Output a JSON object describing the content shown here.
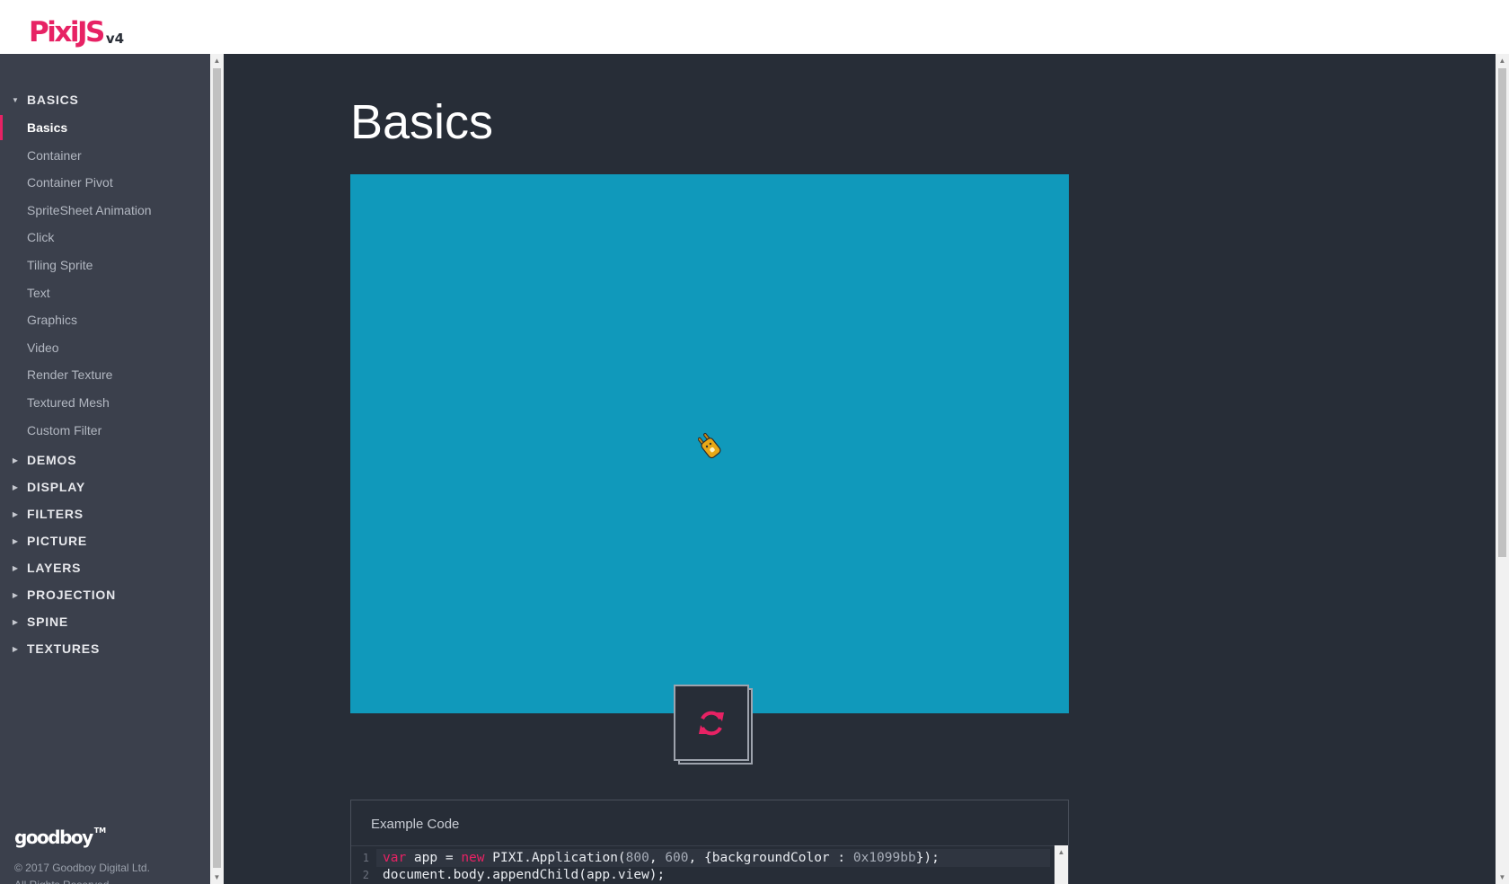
{
  "header": {
    "logo_text": "PixiJS",
    "logo_version": "v4"
  },
  "sidebar": {
    "sections": [
      {
        "label": "BASICS",
        "expanded": true
      },
      {
        "label": "DEMOS",
        "expanded": false
      },
      {
        "label": "DISPLAY",
        "expanded": false
      },
      {
        "label": "FILTERS",
        "expanded": false
      },
      {
        "label": "PICTURE",
        "expanded": false
      },
      {
        "label": "LAYERS",
        "expanded": false
      },
      {
        "label": "PROJECTION",
        "expanded": false
      },
      {
        "label": "SPINE",
        "expanded": false
      },
      {
        "label": "TEXTURES",
        "expanded": false
      }
    ],
    "basics_items": [
      {
        "label": "Basics",
        "active": true
      },
      {
        "label": "Container"
      },
      {
        "label": "Container Pivot"
      },
      {
        "label": "SpriteSheet Animation"
      },
      {
        "label": "Click"
      },
      {
        "label": "Tiling Sprite"
      },
      {
        "label": "Text"
      },
      {
        "label": "Graphics"
      },
      {
        "label": "Video"
      },
      {
        "label": "Render Texture"
      },
      {
        "label": "Textured Mesh"
      },
      {
        "label": "Custom Filter"
      }
    ],
    "brand": "goodboy",
    "brand_tm": "TM",
    "copyright_line1": "© 2017 Goodboy Digital Ltd.",
    "copyright_line2": "All Rights Reserved."
  },
  "main": {
    "title": "Basics",
    "stage_color": "#1099bb",
    "reload_icon": "refresh-icon",
    "code_panel": {
      "title": "Example Code",
      "lines": [
        {
          "num": "1",
          "tokens": [
            {
              "t": "var",
              "c": "kw"
            },
            {
              "t": " app = ",
              "c": ""
            },
            {
              "t": "new",
              "c": "kw"
            },
            {
              "t": " PIXI.Application(",
              "c": ""
            },
            {
              "t": "800",
              "c": "num"
            },
            {
              "t": ", ",
              "c": ""
            },
            {
              "t": "600",
              "c": "num"
            },
            {
              "t": ", {backgroundColor : ",
              "c": ""
            },
            {
              "t": "0x1099bb",
              "c": "num"
            },
            {
              "t": "});",
              "c": ""
            }
          ]
        },
        {
          "num": "2",
          "tokens": [
            {
              "t": "document.body.appendChild(app.view);",
              "c": ""
            }
          ]
        }
      ]
    }
  },
  "colors": {
    "accent": "#e72264",
    "sidebar_bg": "#3b404c",
    "content_bg": "#272d37"
  }
}
